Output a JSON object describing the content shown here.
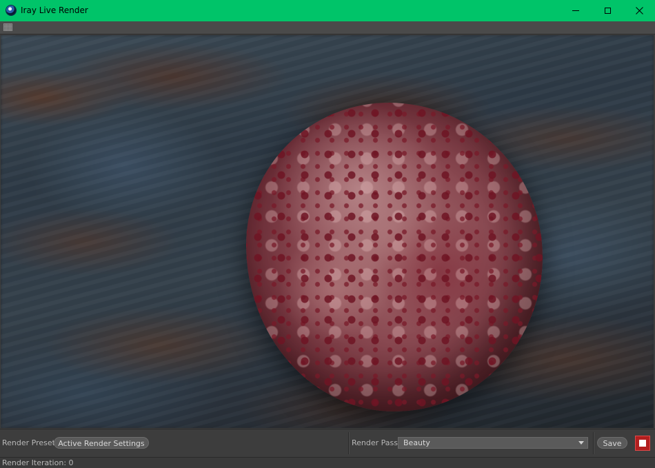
{
  "window": {
    "title": "Iray Live Render",
    "controls": [
      "minimize-icon",
      "maximize-icon",
      "close-icon"
    ],
    "titlebar_color": "#00c469"
  },
  "toolbar": {
    "grip_icon": "grip-icon"
  },
  "controls": {
    "render_preset_label": "Render Preset",
    "render_preset_button": "Active Render Settings",
    "render_pass_label": "Render Pass",
    "render_pass_value": "Beauty",
    "save_label": "Save",
    "stop_icon": "stop-icon",
    "stop_color": "#b21f1f"
  },
  "status": {
    "text": "Render Iteration: 0"
  }
}
